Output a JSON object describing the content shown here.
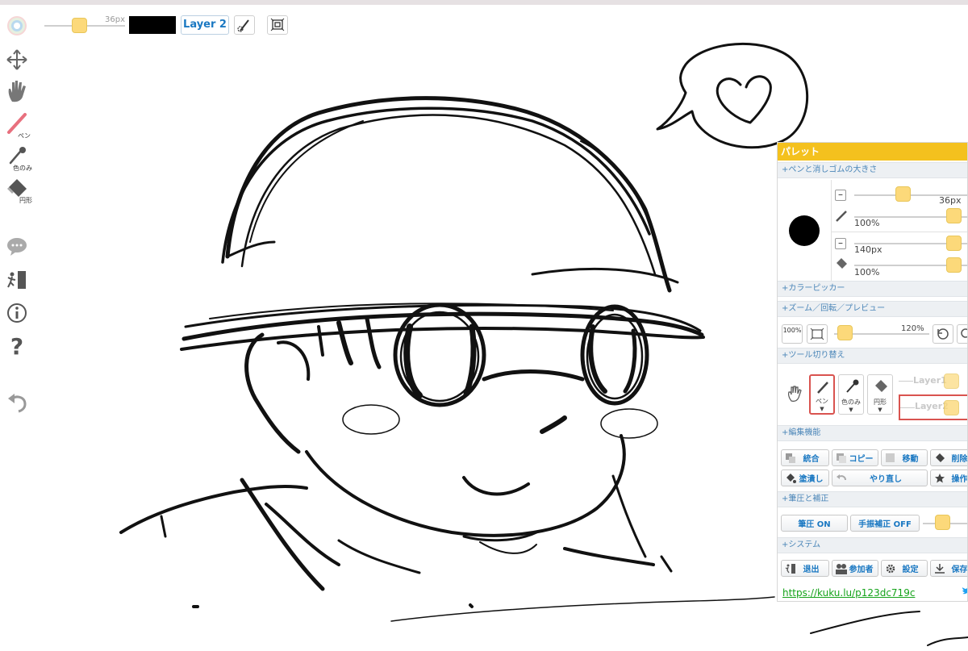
{
  "toolbar": {
    "brush_size": "36px",
    "current_color": "#000000",
    "layer_button": "Layer 2",
    "tool_button_1_icon": "brush-settings-icon",
    "tool_button_2_icon": "fit-canvas-icon"
  },
  "left_tools": {
    "color_wheel_icon": "color-wheel-icon",
    "move_icon": "move-arrows-icon",
    "hand_icon": "hand-icon",
    "pen_label": "ペン",
    "eyedropper_label": "色のみ",
    "eraser_label": "円形",
    "chat_icon": "chat-bubble-icon",
    "exit_icon": "exit-door-icon",
    "info_icon": "info-icon",
    "help_icon": "question-icon",
    "undo_icon": "undo-arrow-icon"
  },
  "palette": {
    "title": "パレット",
    "sections": {
      "size": "+ペンと消しゴムの大きさ",
      "picker": "+カラーピッカー",
      "zoom": "+ズーム／回転／プレビュー",
      "tools": "+ツール切り替え",
      "edit": "+編集機能",
      "pressure": "+筆圧と補正",
      "system": "+システム"
    },
    "pen_size": "36px",
    "pen_opacity": "100%",
    "eraser_size": "140px",
    "eraser_opacity": "100%",
    "zoom_fit_label": "100%",
    "zoom_value": "120%",
    "tool_pen": "ペン",
    "tool_eyedropper": "色のみ",
    "tool_eraser": "円形",
    "layer1": "Layer1",
    "layer2": "Layer2",
    "edit_buttons": {
      "merge": "統合",
      "copy": "コピー",
      "move": "移動",
      "delete": "削除",
      "fill": "塗潰し",
      "redo": "やり直し",
      "operate": "操作"
    },
    "pressure_on": "筆圧 ON",
    "stabilizer_off": "手振補正 OFF",
    "system_buttons": {
      "exit": "退出",
      "members": "参加者",
      "settings": "設定",
      "save": "保存"
    },
    "url": "https://kuku.lu/p123dc719c",
    "accent_color": "#f4c11e",
    "link_color": "#1a78c2"
  }
}
